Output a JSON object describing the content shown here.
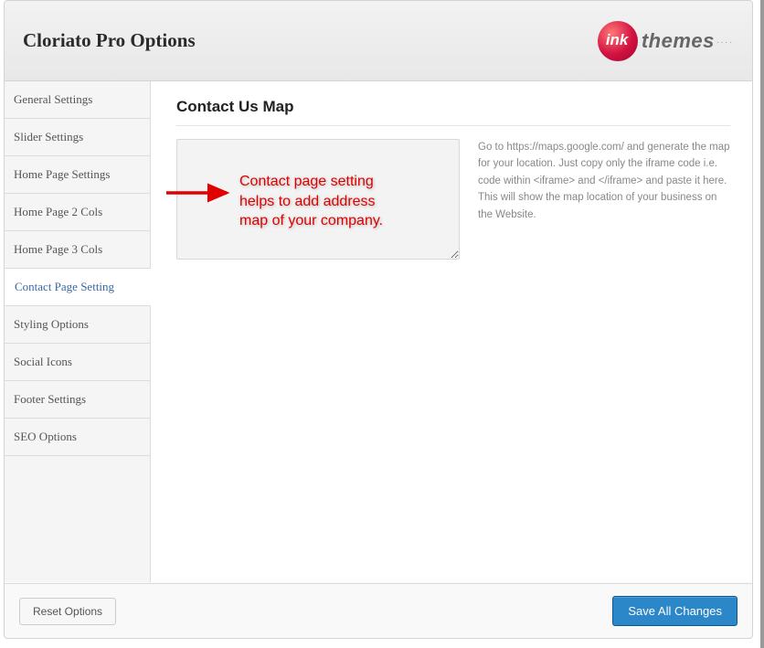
{
  "header": {
    "title": "Cloriato Pro Options",
    "brand_suffix": "themes"
  },
  "sidebar": {
    "items": [
      {
        "label": "General Settings"
      },
      {
        "label": "Slider Settings"
      },
      {
        "label": "Home Page Settings"
      },
      {
        "label": "Home Page 2 Cols"
      },
      {
        "label": "Home Page 3 Cols"
      },
      {
        "label": "Contact Page Setting"
      },
      {
        "label": "Styling Options"
      },
      {
        "label": "Social Icons"
      },
      {
        "label": "Footer Settings"
      },
      {
        "label": "SEO Options"
      }
    ],
    "active_index": 5
  },
  "main": {
    "section_title": "Contact Us Map",
    "map_value": "",
    "help_text": "Go to https://maps.google.com/ and generate the map for your location. Just copy only the iframe code i.e. code within <iframe> and </iframe> and paste it here. This will show the map location of your business on the Website."
  },
  "annotation": {
    "line1": "Contact page setting",
    "line2": "helps to add address",
    "line3": "map of your company."
  },
  "footer": {
    "reset_label": "Reset Options",
    "save_label": "Save All Changes"
  }
}
